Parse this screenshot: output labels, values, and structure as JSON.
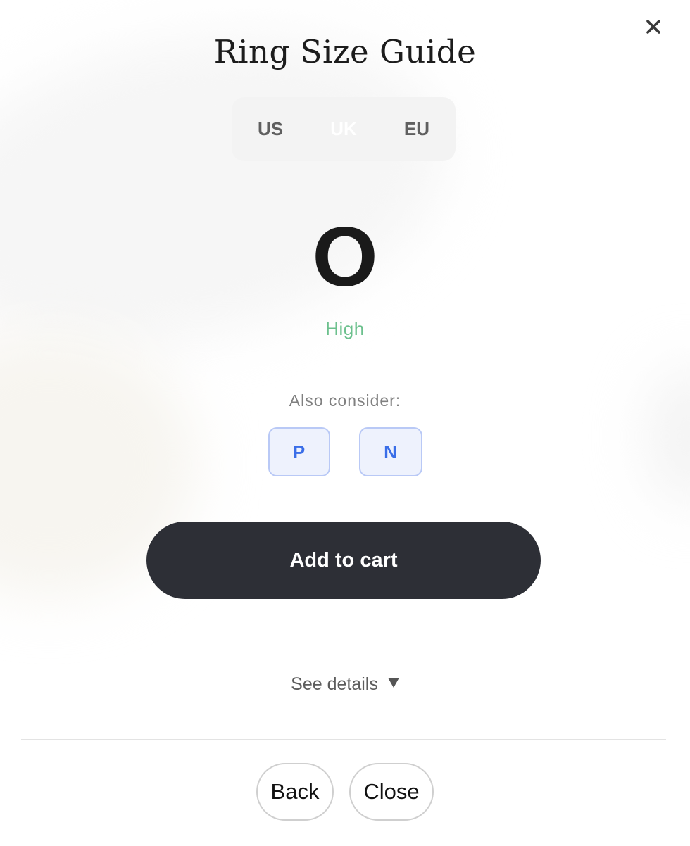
{
  "modal": {
    "title": "Ring Size Guide",
    "close_icon": "close-icon"
  },
  "unit_tabs": [
    {
      "label": "US",
      "active": false
    },
    {
      "label": "UK",
      "active": true
    },
    {
      "label": "EU",
      "active": false
    }
  ],
  "result": {
    "size": "O",
    "confidence": "High",
    "confidence_color": "#6cc08d"
  },
  "alternatives": {
    "label": "Also consider:",
    "sizes": [
      "P",
      "N"
    ],
    "accent_color": "#3a6ee8"
  },
  "actions": {
    "add_to_cart": "Add to cart",
    "see_details": "See details",
    "see_details_icon": "triangle-down-icon",
    "back": "Back",
    "close": "Close"
  },
  "colors": {
    "primary_button": "#2d2f36",
    "tab_background": "#f3f3f3"
  }
}
